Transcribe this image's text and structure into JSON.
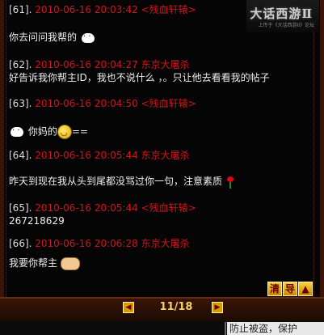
{
  "brand": {
    "title": "大话西游Ⅱ",
    "subtitle": "上传于《大话西游II》论坛"
  },
  "messages": [
    {
      "index": "[61].",
      "date": "2010-06-16 20:03:42",
      "user": "<残血轩辕>",
      "text": "你去问问我帮的",
      "emoji": "bunny-icon"
    },
    {
      "index": "[62].",
      "date": "2010-06-16 20:04:27",
      "user": "东京大屠杀",
      "text": "好告诉我你帮主ID，我也不说什么 ，。只让他去看看我的帖子",
      "emoji": ""
    },
    {
      "index": "[63].",
      "date": "2010-06-16 20:04:50",
      "user": "<残血轩辕>",
      "text": "你妈的",
      "text_suffix": "==",
      "emoji": "bunny-icon"
    },
    {
      "index": "[64].",
      "date": "2010-06-16 20:05:44",
      "user": "东京大屠杀",
      "text": "昨天到现在我从头到尾都没骂过你一句，注意素质",
      "emoji": "rose-icon"
    },
    {
      "index": "[65].",
      "date": "2010-06-16 20:05:44",
      "user": "<残血轩辕>",
      "text": "267218629",
      "emoji": ""
    },
    {
      "index": "[66].",
      "date": "2010-06-16 20:06:28",
      "user": "东京大屠杀",
      "text": "我要你帮主",
      "emoji": "handshake-icon"
    }
  ],
  "toolbar": {
    "clear_label": "清",
    "export_label": "导"
  },
  "pager": {
    "current": "11/18",
    "prev_glyph": "◀",
    "next_glyph": "▶"
  },
  "footer": {
    "notice": "防止被盗，保护"
  }
}
